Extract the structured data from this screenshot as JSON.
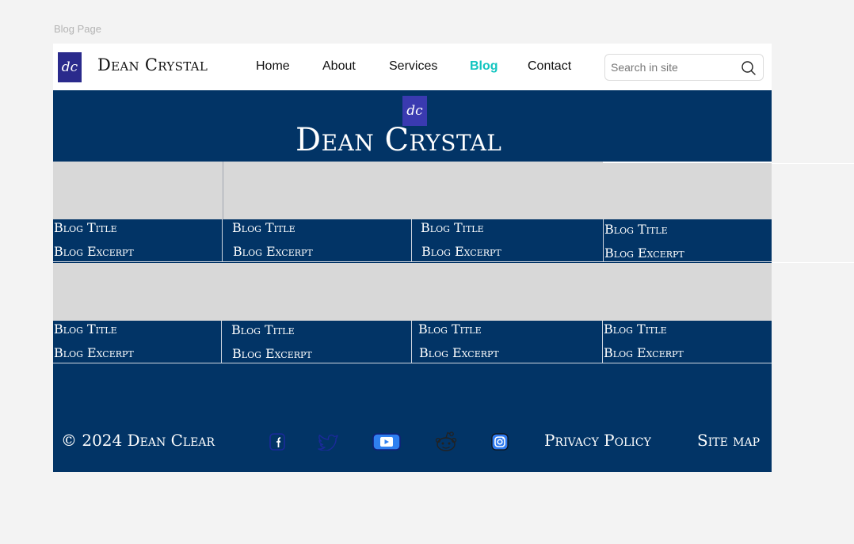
{
  "page_label": "Blog Page",
  "header": {
    "logo_text": "dc",
    "brand": "Dean Crystal",
    "nav": [
      "Home",
      "About",
      "Services",
      "Blog",
      "Contact"
    ],
    "active_nav": "Blog",
    "search_placeholder": "Search in site",
    "search_icon": "search-icon"
  },
  "hero": {
    "logo_text": "dc",
    "title": "Dean Crystal"
  },
  "posts_row1": [
    {
      "title": "Blog Title",
      "excerpt": "Blog Excerpt"
    },
    {
      "title": "Blog Title",
      "excerpt": "Blog Excerpt"
    },
    {
      "title": "Blog Title",
      "excerpt": "Blog Excerpt"
    },
    {
      "title": "Blog Title",
      "excerpt": "Blog Excerpt"
    }
  ],
  "posts_row2": [
    {
      "title": "Blog Title",
      "excerpt": "Blog Excerpt"
    },
    {
      "title": "Blog Title",
      "excerpt": "Blog Excerpt"
    },
    {
      "title": "Blog Title",
      "excerpt": "Blog Excerpt"
    },
    {
      "title": "Blog Title",
      "excerpt": "Blog Excerpt"
    }
  ],
  "footer": {
    "copyright": "© 2024 Dean Clear",
    "social_icons": [
      "facebook-icon",
      "twitter-icon",
      "youtube-icon",
      "reddit-icon",
      "instagram-icon"
    ],
    "privacy": "Privacy Policy",
    "sitemap": "Site map"
  },
  "colors": {
    "navy": "#023466",
    "accent": "#12c5c0",
    "placeholder_image": "#d8d8d8",
    "page_bg": "#f3f3f3"
  }
}
